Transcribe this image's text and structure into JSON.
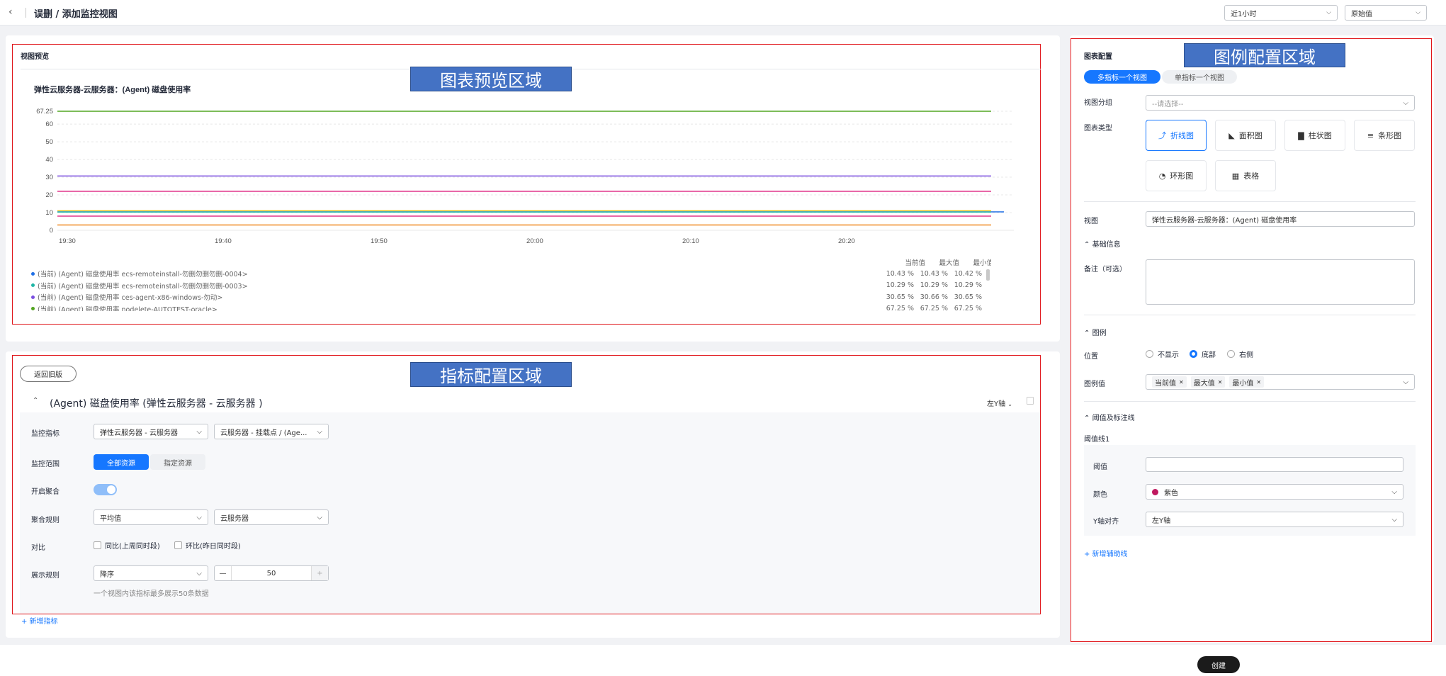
{
  "header": {
    "title": "误删 / 添加监控视图",
    "time_range": "近1小时",
    "value_type": "原始值"
  },
  "annotations": {
    "preview_area": "图表预览区域",
    "legend_area": "图例配置区域",
    "metric_area": "指标配置区域"
  },
  "preview": {
    "section_title": "视图预览",
    "legend_headers": [
      "当前值",
      "最大值",
      "最小值"
    ],
    "legend_rows": [
      {
        "name": "(当前) (Agent) 磁盘使用率 ecs-remoteinstall-勿删勿删勿删-0004>",
        "color": "#1f6fe5",
        "cur": "10.43 %",
        "max": "10.43 %",
        "min": "10.42 %"
      },
      {
        "name": "(当前) (Agent) 磁盘使用率 ecs-remoteinstall-勿删勿删勿删-0003>",
        "color": "#1fb5a5",
        "cur": "10.29 %",
        "max": "10.29 %",
        "min": "10.29 %"
      },
      {
        "name": "(当前) (Agent) 磁盘使用率 ces-agent-x86-windows-勿动>",
        "color": "#7b4fe0",
        "cur": "30.65 %",
        "max": "30.66 %",
        "min": "30.65 %"
      },
      {
        "name": "(当前) (Agent) 磁盘使用率 nodelete-AUTOTEST-oracle>",
        "color": "#52a520",
        "cur": "67.25 %",
        "max": "67.25 %",
        "min": "67.25 %"
      }
    ]
  },
  "chart_data": {
    "type": "line",
    "title": "弹性云服务器-云服务器：(Agent) 磁盘使用率",
    "x_ticks": [
      "19:30",
      "19:40",
      "19:50",
      "20:00",
      "20:10",
      "20:20"
    ],
    "y_ticks": [
      "0",
      "10",
      "20",
      "30",
      "40",
      "50",
      "60",
      "67.25"
    ],
    "ylim": [
      0,
      67.25
    ],
    "series": [
      {
        "color": "#52a520",
        "values": [
          67.25,
          67.25
        ]
      },
      {
        "color": "#7b4fe0",
        "values": [
          30.65,
          30.65
        ]
      },
      {
        "color": "#e0368c",
        "values": [
          22,
          22
        ]
      },
      {
        "color": "#e8c21a",
        "values": [
          11,
          11
        ]
      },
      {
        "color": "#1f6fe5",
        "values": [
          10.43,
          10.43
        ]
      },
      {
        "color": "#1fb5a5",
        "values": [
          10.29,
          10.29
        ]
      },
      {
        "color": "#e0368c",
        "values": [
          8,
          8
        ]
      },
      {
        "color": "#f08a24",
        "values": [
          3,
          3
        ]
      }
    ]
  },
  "metric": {
    "back_label": "返回旧版",
    "heading": "(Agent) 磁盘使用率 (弹性云服务器 - 云服务器 )",
    "axis_label": "左Y轴",
    "rows": {
      "metric_label": "监控指标",
      "metric_sel1": "弹性云服务器 - 云服务器",
      "metric_sel2": "云服务器 - 挂载点 / (Age...",
      "scope_label": "监控范围",
      "scope_all": "全部资源",
      "scope_specific": "指定资源",
      "agg_on_label": "开启聚合",
      "agg_rule_label": "聚合规则",
      "agg_sel1": "平均值",
      "agg_sel2": "云服务器",
      "compare_label": "对比",
      "compare_yoy": "同比(上周同时段)",
      "compare_mom": "环比(昨日同时段)",
      "display_label": "展示规则",
      "display_sel": "降序",
      "display_count": "50",
      "display_hint": "一个视图内该指标最多展示50条数据"
    },
    "add_metric": "+ 新增指标"
  },
  "config": {
    "section_title": "图表配置",
    "tab_multi": "多指标一个视图",
    "tab_single": "单指标一个视图",
    "group_label": "视图分组",
    "group_placeholder": "--请选择--",
    "type_label": "图表类型",
    "types": [
      "折线图",
      "面积图",
      "柱状图",
      "条形图",
      "环形图",
      "表格"
    ],
    "view_label": "视图",
    "view_value": "弹性云服务器-云服务器：(Agent) 磁盘使用率",
    "basic_info": "基础信息",
    "remark_label": "备注（可选）",
    "legend_section": "图例",
    "position_label": "位置",
    "pos_none": "不显示",
    "pos_bottom": "底部",
    "pos_right": "右侧",
    "legend_value_label": "图例值",
    "legend_tags": [
      "当前值",
      "最大值",
      "最小值"
    ],
    "threshold_section": "阈值及标注线",
    "threshold_line": "阈值线1",
    "threshold_label": "阈值",
    "color_label": "颜色",
    "color_value": "紫色",
    "color_swatch": "#c0185f",
    "yaxis_label": "Y轴对齐",
    "yaxis_value": "左Y轴",
    "add_line": "+ 新增辅助线"
  },
  "footer": {
    "create": "创建"
  }
}
